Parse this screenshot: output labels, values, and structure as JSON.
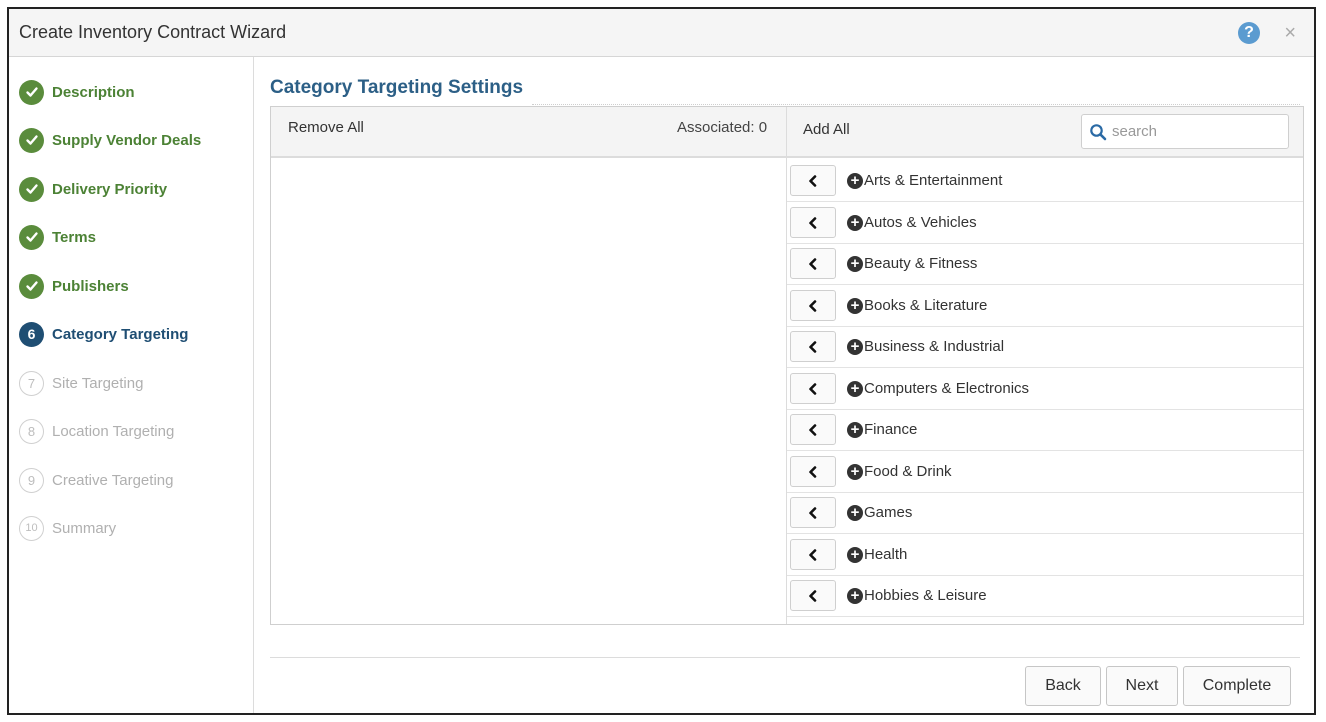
{
  "window": {
    "title": "Create Inventory Contract Wizard",
    "help_icon": "?",
    "close_icon": "×"
  },
  "steps": [
    {
      "number": "1",
      "label": "Description",
      "state": "done"
    },
    {
      "number": "2",
      "label": "Supply Vendor Deals",
      "state": "done"
    },
    {
      "number": "3",
      "label": "Delivery Priority",
      "state": "done"
    },
    {
      "number": "4",
      "label": "Terms",
      "state": "done"
    },
    {
      "number": "5",
      "label": "Publishers",
      "state": "done"
    },
    {
      "number": "6",
      "label": "Category Targeting",
      "state": "current"
    },
    {
      "number": "7",
      "label": "Site Targeting",
      "state": "todo"
    },
    {
      "number": "8",
      "label": "Location Targeting",
      "state": "todo"
    },
    {
      "number": "9",
      "label": "Creative Targeting",
      "state": "todo"
    },
    {
      "number": "10",
      "label": "Summary",
      "state": "todo"
    }
  ],
  "section": {
    "title": "Category Targeting Settings"
  },
  "selected_panel": {
    "remove_all_label": "Remove All",
    "associated_label": "Associated: 0"
  },
  "available_panel": {
    "add_all_label": "Add All",
    "search_placeholder": "search",
    "search_value": "",
    "items": [
      "Arts & Entertainment",
      "Autos & Vehicles",
      "Beauty & Fitness",
      "Books & Literature",
      "Business & Industrial",
      "Computers & Electronics",
      "Finance",
      "Food & Drink",
      "Games",
      "Health",
      "Hobbies & Leisure"
    ]
  },
  "footer": {
    "back_label": "Back",
    "next_label": "Next",
    "complete_label": "Complete"
  },
  "colors": {
    "done_green": "#5a8c3c",
    "current_blue": "#1f4e73",
    "title_blue": "#2c5f86",
    "help_blue": "#5b9bd0"
  },
  "icons": {
    "step_done": "check-circle-icon",
    "help": "question-circle-icon",
    "close": "close-icon",
    "search": "search-icon",
    "move_left": "chevron-left-icon",
    "add": "plus-circle-icon"
  }
}
